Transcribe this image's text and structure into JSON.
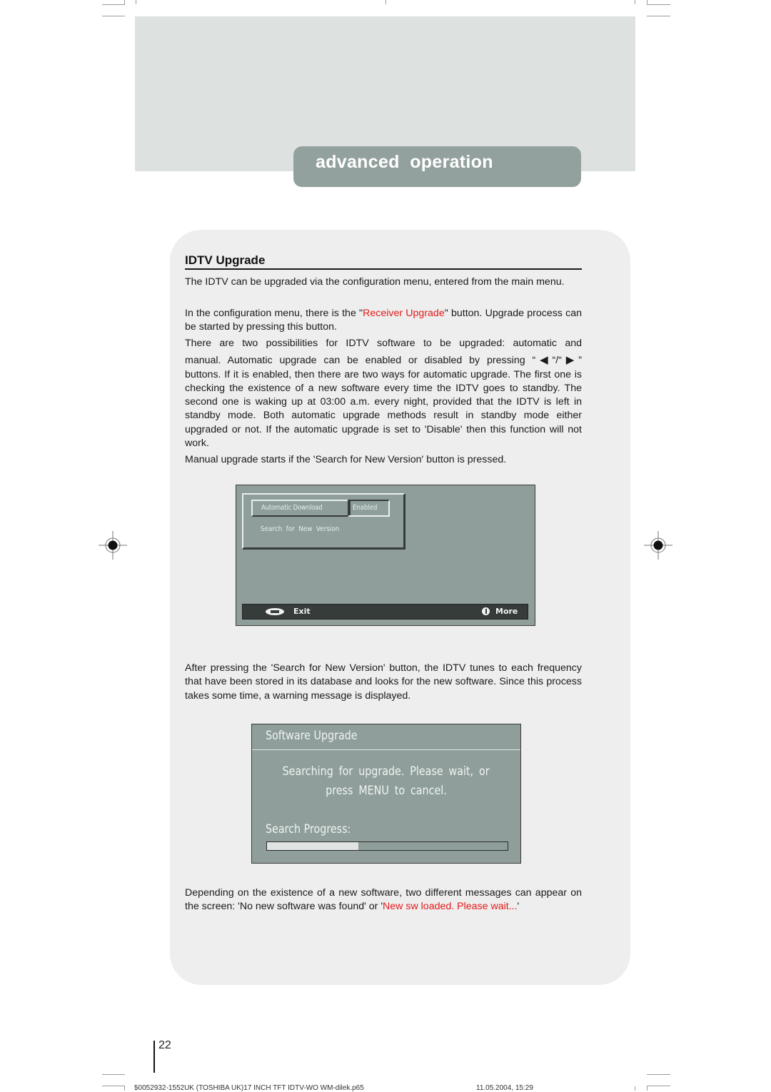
{
  "header": {
    "section_title": "advanced  operation"
  },
  "article": {
    "title": "IDTV Upgrade",
    "p1": "The IDTV can be upgraded via the configuration menu, entered from the main menu.",
    "p2_before": "In the configuration menu, there is the \"",
    "p2_highlight": "Receiver Upgrade",
    "p2_after": "\" button. Upgrade process can be started by pressing this button.",
    "p3_line1": "There are two possibilities for IDTV software to be upgraded: automatic and",
    "p3_line2_before": "manual. Automatic upgrade can be enabled or disabled by pressing “",
    "p3_left_arrow": "◀",
    "p3_sep": "“/“",
    "p3_right_arrow": "▶",
    "p3_line2_after": "”",
    "p3_rest": "buttons. If it is enabled, then there are two ways for automatic upgrade. The first one is checking the existence of a new software every time the IDTV goes to standby. The second one is waking up at 03:00 a.m. every night, provided that the IDTV is left in standby mode. Both automatic upgrade methods result in standby mode either upgraded or not. If the automatic upgrade is set to 'Disable' then this function will not work.",
    "p4": "Manual upgrade starts if the 'Search for New Version' button is pressed.",
    "p5": "After pressing the 'Search for New Version' button, the IDTV tunes to each frequency that have been stored in its database and looks for the new software. Since this process takes some time, a warning message is displayed.",
    "p6_before": "Depending on the existence of a new software, two different messages can appear on the screen: 'No new software was found' or '",
    "p6_highlight": "New sw loaded. Please wait...",
    "p6_after": "'"
  },
  "upgrade_menu": {
    "items": [
      {
        "label": "Automatic Download",
        "value": "Enabled"
      },
      {
        "label": "Search for New Version"
      }
    ],
    "footer": {
      "menu_key_icon": "menu-key-icon",
      "exit_label": "Exit",
      "info_icon": "info-icon",
      "more_label": "More"
    }
  },
  "upgrade_dialog": {
    "title": "Software Upgrade",
    "message_line1": "Searching for upgrade. Please wait, or",
    "message_line2": "press MENU to cancel.",
    "progress_label": "Search Progress:",
    "progress_fraction": 0.38
  },
  "colors": {
    "highlight_red": "#e31b1b",
    "tab_gray": "#93a19e",
    "tv_background": "#8f9e9a"
  },
  "footer": {
    "page_number": "22",
    "slug": "50052932-1552UK (TOSHIBA UK)17 INCH TFT IDTV-WO WM-dilek.p65",
    "overprint": "22",
    "date": "11.05.2004, 15:29"
  }
}
